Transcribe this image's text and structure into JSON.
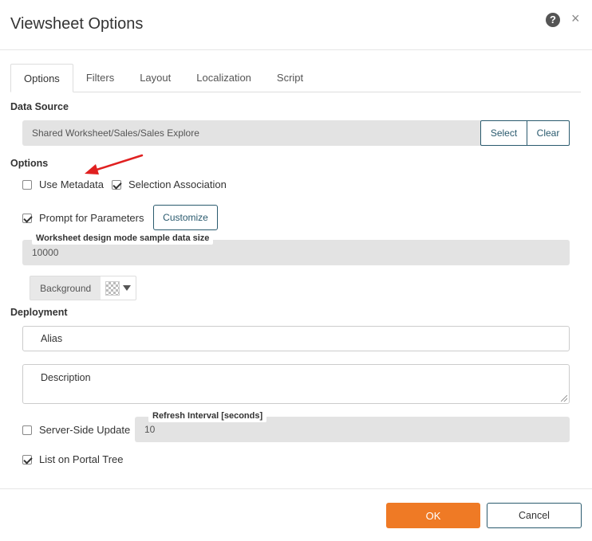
{
  "dialog": {
    "title": "Viewsheet Options",
    "help_icon_glyph": "?",
    "close_icon_glyph": "×"
  },
  "tabs": [
    {
      "label": "Options",
      "active": true
    },
    {
      "label": "Filters",
      "active": false
    },
    {
      "label": "Layout",
      "active": false
    },
    {
      "label": "Localization",
      "active": false
    },
    {
      "label": "Script",
      "active": false
    }
  ],
  "data_source": {
    "label": "Data Source",
    "value": "Shared Worksheet/Sales/Sales Explore",
    "select_label": "Select",
    "clear_label": "Clear"
  },
  "options": {
    "label": "Options",
    "use_metadata": {
      "label": "Use Metadata",
      "checked": false
    },
    "selection_association": {
      "label": "Selection Association",
      "checked": true
    },
    "prompt_for_parameters": {
      "label": "Prompt for Parameters",
      "checked": true
    },
    "customize_label": "Customize",
    "sample_size": {
      "label": "Worksheet design mode sample data size",
      "value": "10000"
    },
    "background": {
      "label": "Background"
    }
  },
  "deployment": {
    "label": "Deployment",
    "alias": {
      "placeholder": "Alias",
      "value": ""
    },
    "description": {
      "placeholder": "Description",
      "value": ""
    },
    "server_side_update": {
      "label": "Server-Side Update",
      "checked": false
    },
    "refresh_interval": {
      "label": "Refresh Interval [seconds]",
      "value": "10"
    },
    "list_on_portal_tree": {
      "label": "List on Portal Tree",
      "checked": true
    }
  },
  "footer": {
    "ok_label": "OK",
    "cancel_label": "Cancel"
  },
  "colors": {
    "accent": "#ef7a25",
    "outline": "#2a5a6e",
    "annotation_arrow": "#e02020"
  }
}
